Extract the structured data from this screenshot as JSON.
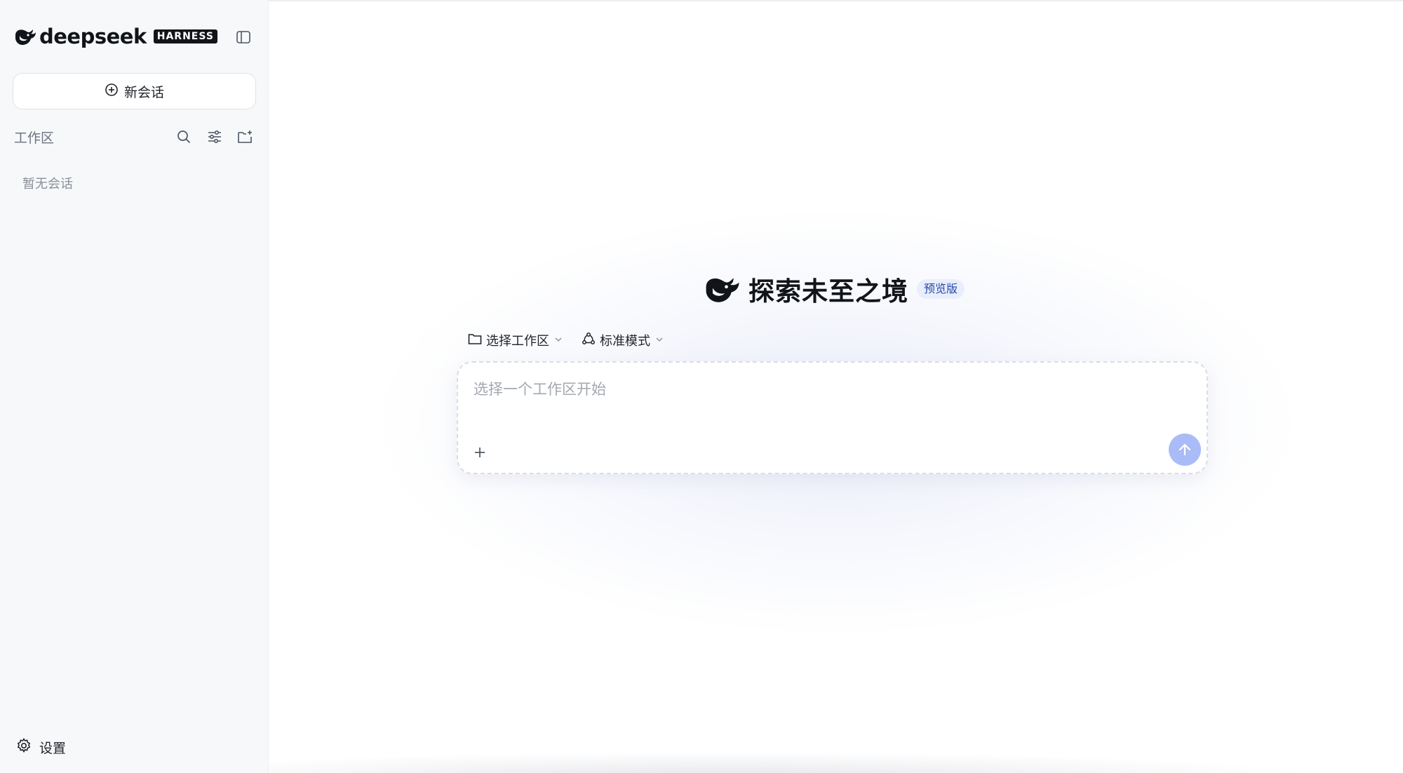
{
  "brand": {
    "wordmark": "deepseek",
    "badge": "HARNESS"
  },
  "sidebar": {
    "new_chat_label": "新会话",
    "workspace_label": "工作区",
    "empty_text": "暂无会话",
    "settings_label": "设置"
  },
  "main": {
    "title": "探索未至之境",
    "preview_badge": "预览版",
    "workspace_selector_label": "选择工作区",
    "mode_selector_label": "标准模式",
    "input_placeholder": "选择一个工作区开始"
  },
  "colors": {
    "accent": "#a9bcf7",
    "badge_bg": "#e8eefc",
    "badge_text": "#2948a8",
    "sidebar_bg": "#f7f8fa"
  },
  "icons": {
    "logo": "whale-icon",
    "toggle": "sidebar-toggle-icon",
    "new_chat": "plus-circle-icon",
    "search": "search-icon",
    "filter": "sliders-icon",
    "new_folder": "folder-plus-icon",
    "settings": "gear-icon",
    "folder": "folder-icon",
    "mode": "cycle-icon",
    "chevron": "chevron-down-icon",
    "attach": "plus-icon",
    "send": "arrow-up-icon"
  }
}
